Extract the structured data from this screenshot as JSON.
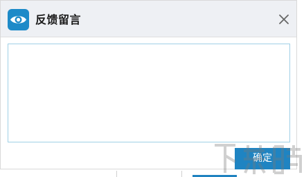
{
  "dialog": {
    "title": "反馈留言",
    "logo_icon": "eye-icon",
    "close_icon": "close-icon",
    "message_value": "",
    "confirm_label": "确定"
  },
  "colors": {
    "accent": "#1f84c2",
    "titlebar_bg": "#eef0f4",
    "textarea_border": "#9fd0e6"
  },
  "watermark": {
    "text": "下载吧"
  }
}
